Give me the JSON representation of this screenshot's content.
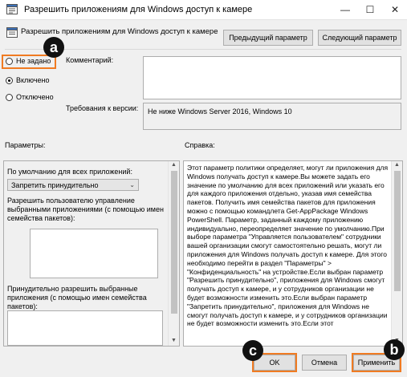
{
  "window": {
    "title": "Разрешить приложениям для Windows доступ к камере"
  },
  "header": {
    "policy_name": "Разрешить приложениям для Windows доступ к камере",
    "prev_button": "Предыдущий параметр",
    "next_button": "Следующий параметр"
  },
  "state_options": {
    "not_configured": "Не задано",
    "enabled": "Включено",
    "disabled": "Отключено",
    "selected": "Включено"
  },
  "comment": {
    "label": "Комментарий:",
    "value": ""
  },
  "supported_on": {
    "label": "Требования к версии:",
    "value": "Не ниже Windows Server 2016, Windows 10"
  },
  "options_pane": {
    "heading": "Параметры:",
    "default_label": "По умолчанию для всех приложений:",
    "default_select": "Запретить принудительно",
    "user_control_label": "Разрешить пользователю управление выбранными приложениями (с помощью имен семейства пакетов):",
    "force_allow_label": "Принудительно разрешить выбранные приложения (с помощью имен семейства пакетов):"
  },
  "help_pane": {
    "heading": "Справка:",
    "text": "Этот параметр политики определяет, могут ли приложения для Windows получать доступ к камере.Вы можете задать его значение по умолчанию для всех приложений или указать его для каждого приложения отдельно, указав имя семейства пакетов. Получить имя семейства пакетов для приложения можно с помощью командлета Get-AppPackage Windows PowerShell. Параметр, заданный каждому приложению индивидуально, переопределяет значение по умолчанию.При выборе параметра \"Управляется пользователем\" сотрудники вашей организации смогут самостоятельно решать, могут ли приложения для Windows получать доступ к камере. Для этого необходимо перейти в раздел \"Параметры\" > \"Конфиденциальность\" на устройстве.Если выбран параметр \"Разрешить принудительно\", приложения для Windows смогут получать доступ к камере, и у сотрудников организации не будет возможности изменить это.Если выбран параметр \"Запретить принудительно\", приложения для Windows не смогут получать доступ к камере, и у сотрудников организации не будет возможности изменить это.Если этот"
  },
  "footer": {
    "ok": "OK",
    "cancel": "Отмена",
    "apply": "Применить"
  },
  "annotations": {
    "a": "a",
    "b": "b",
    "c": "c"
  },
  "icons": {
    "window_icon": "policy-settings-icon",
    "header_icon": "policy-settings-icon",
    "minimize": "minimize-icon",
    "maximize": "maximize-icon",
    "close": "close-icon",
    "dropdown": "chevron-down-icon",
    "scroll_up": "scroll-up-arrow-icon",
    "scroll_down": "scroll-down-arrow-icon"
  },
  "colors": {
    "highlight": "#f07b22",
    "window_bg": "#f0f0f0",
    "button_bg": "#e1e1e1",
    "badge_bg": "#111111"
  }
}
